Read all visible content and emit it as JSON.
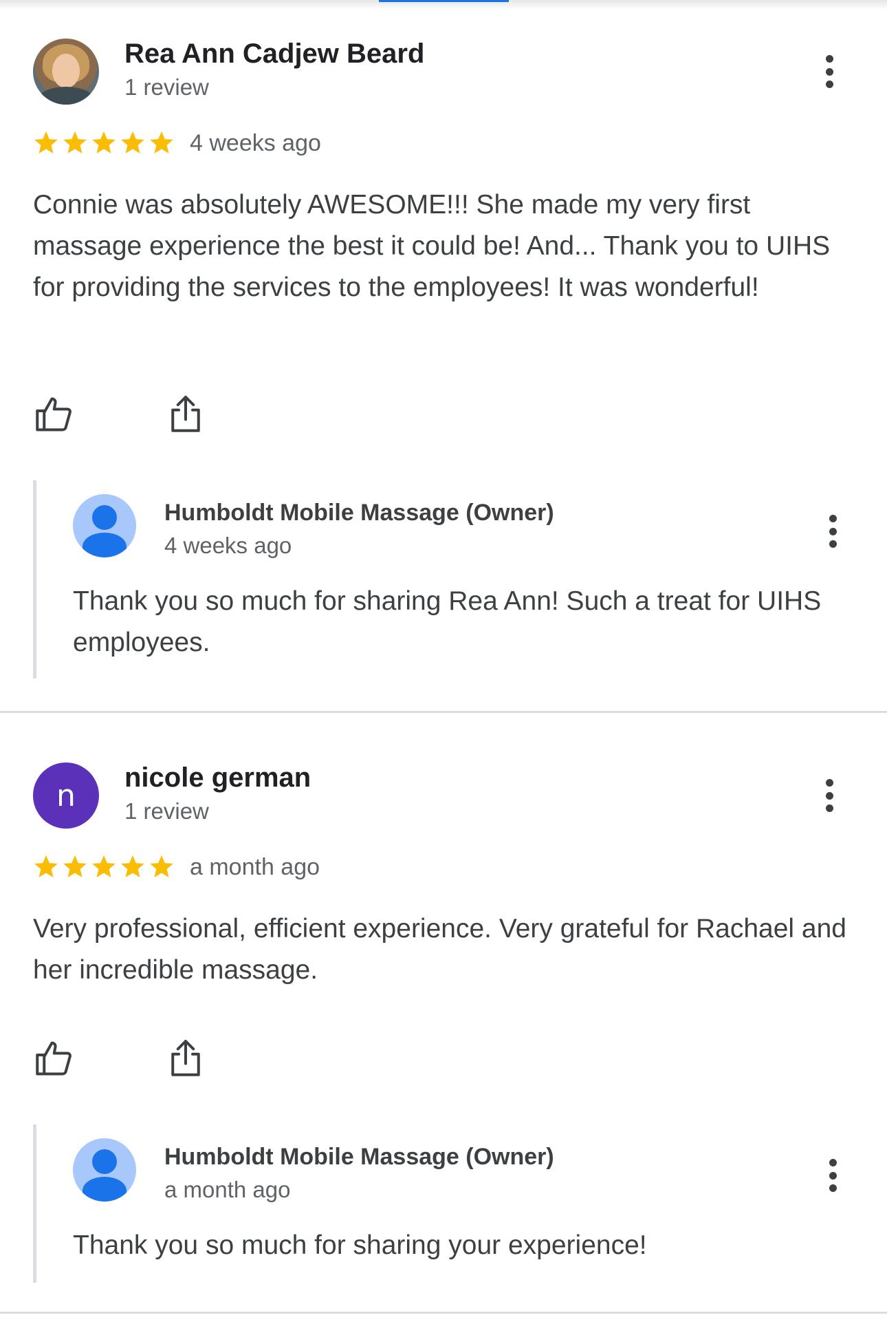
{
  "reviews": [
    {
      "reviewer_name": "Rea Ann Cadjew Beard",
      "review_count": "1 review",
      "avatar": "profile-photo",
      "rating": 5,
      "date": "4 weeks ago",
      "text": "Connie was absolutely AWESOME!!! She made my very first massage experience the best it could be! And... Thank you to UIHS for providing the services to the employees! It was wonderful!",
      "owner_reply": {
        "name": "Humboldt Mobile Massage (Owner)",
        "date": "4 weeks ago",
        "text": "Thank you so much for sharing Rea Ann! Such a treat for UIHS employees."
      }
    },
    {
      "reviewer_name": "nicole german",
      "review_count": "1 review",
      "avatar_letter": "n",
      "avatar_color": "#5a31b8",
      "rating": 5,
      "date": "a month ago",
      "text": "Very professional, efficient experience. Very grateful for Rachael and her incredible massage.",
      "owner_reply": {
        "name": "Humboldt Mobile Massage (Owner)",
        "date": "a month ago",
        "text": "Thank you so much for sharing your experience!"
      }
    }
  ],
  "icons": {
    "star": "star-icon",
    "like": "thumbs-up-icon",
    "share": "share-icon",
    "more": "more-vertical-icon"
  },
  "colors": {
    "star": "#fbbc04",
    "accent": "#1a73e8",
    "divider": "#dadce0"
  }
}
